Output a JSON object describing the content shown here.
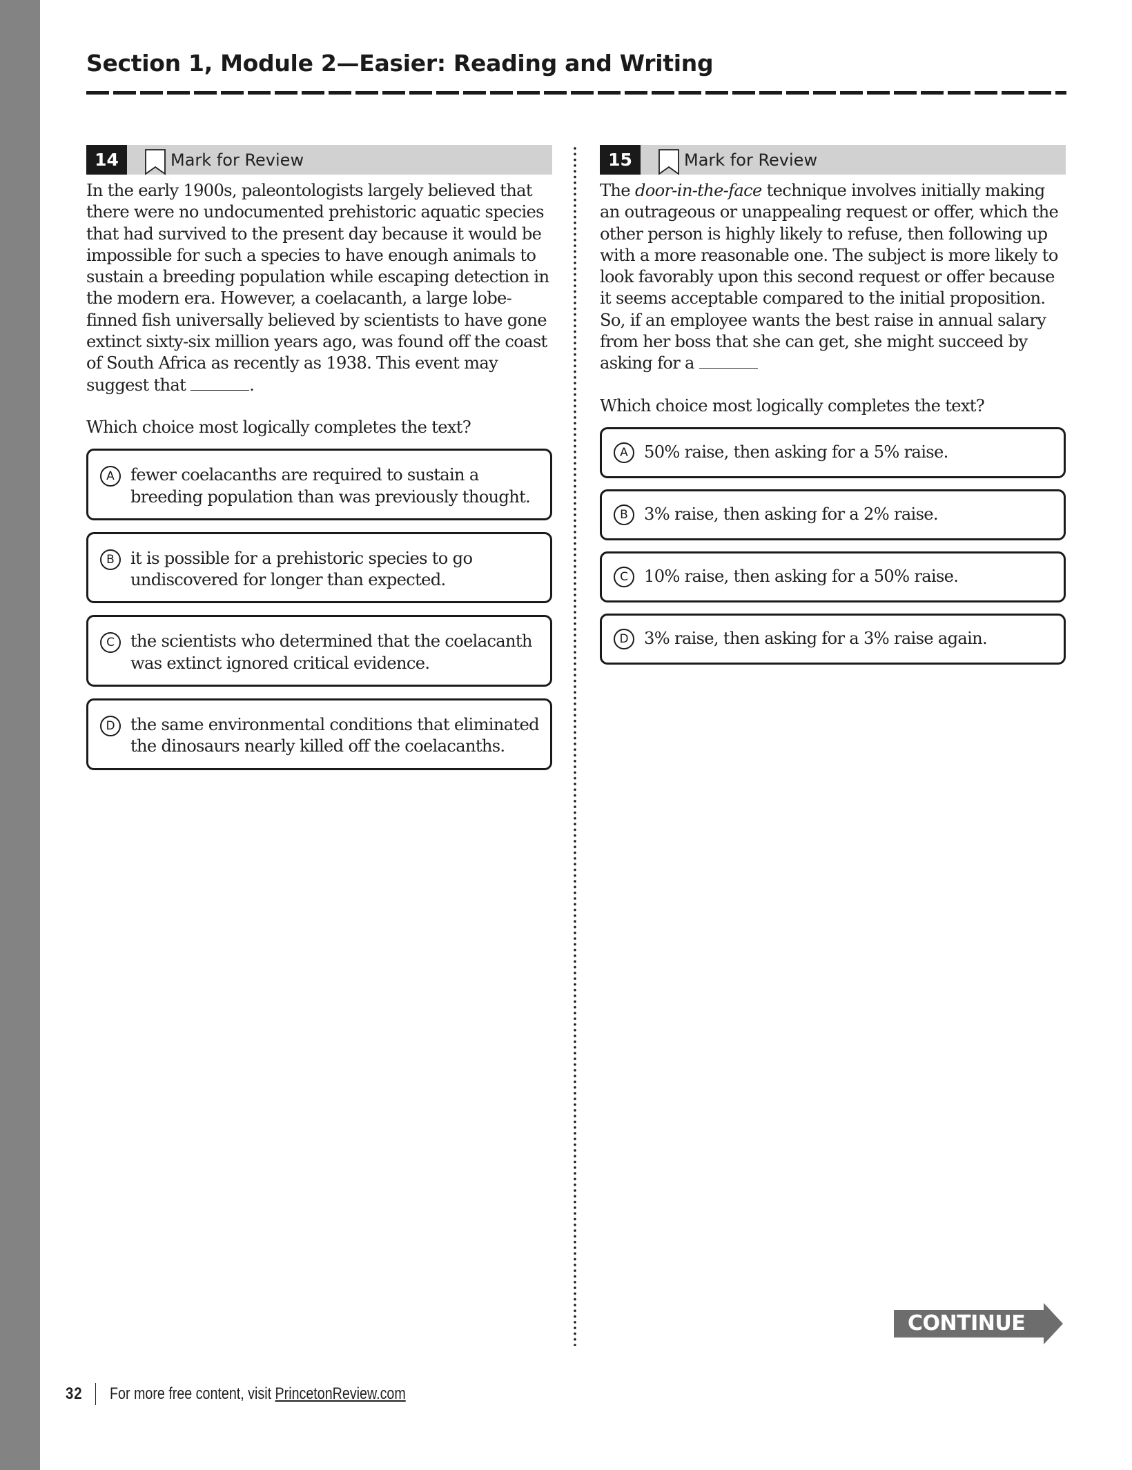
{
  "header": {
    "section_title": "Section 1, Module 2—Easier: Reading and Writing"
  },
  "questions": [
    {
      "number": "14",
      "mark_label": "Mark for Review",
      "passage": "In the early 1900s, paleontologists largely believed that there were no undocumented prehistoric aquatic species that had survived to the present day because it would be impossible for such a species to have enough animals to sustain a breeding population while escaping detection in the modern era. However, a coelacanth, a large lobe-finned fish universally believed by scientists to have gone extinct sixty-six million years ago, was found off the coast of South Africa as recently as 1938. This event may suggest that",
      "passage_end": ".",
      "prompt": "Which choice most logically completes the text?",
      "choices": [
        {
          "letter": "A",
          "text": "fewer coelacanths are required to sustain a breeding population than was previously thought."
        },
        {
          "letter": "B",
          "text": "it is possible for a prehistoric species to go undiscovered for longer than expected."
        },
        {
          "letter": "C",
          "text": "the scientists who determined that the coelacanth was extinct ignored critical evidence."
        },
        {
          "letter": "D",
          "text": "the same environmental conditions that eliminated the dinosaurs nearly killed off the coelacanths."
        }
      ]
    },
    {
      "number": "15",
      "mark_label": "Mark for Review",
      "passage_start": "The",
      "passage_italic": "door-in-the-face",
      "passage_rest": "technique involves initially making an outrageous or unappealing request or offer, which the other person is highly likely to refuse, then following up with a more reasonable one. The subject is more likely to look favorably upon this second request or offer because it seems acceptable compared to the initial proposition. So, if an employee wants the best raise in annual salary from her boss that she can get, she might succeed by asking for a",
      "prompt": "Which choice most logically completes the text?",
      "choices": [
        {
          "letter": "A",
          "text": "50% raise, then asking for a 5% raise."
        },
        {
          "letter": "B",
          "text": "3% raise, then asking for a 2% raise."
        },
        {
          "letter": "C",
          "text": "10% raise, then asking for a 50% raise."
        },
        {
          "letter": "D",
          "text": "3% raise, then asking for a 3% raise again."
        }
      ]
    }
  ],
  "continue_label": "CONTINUE",
  "footer": {
    "page_number": "32",
    "text": "For more free content, visit ",
    "link_text": "PrincetonReview.com"
  },
  "colors": {
    "side_bar": "#838383",
    "header_bar": "#d1d1d1",
    "number_box": "#1a1a1a",
    "continue_button": "#6d6d6d"
  }
}
